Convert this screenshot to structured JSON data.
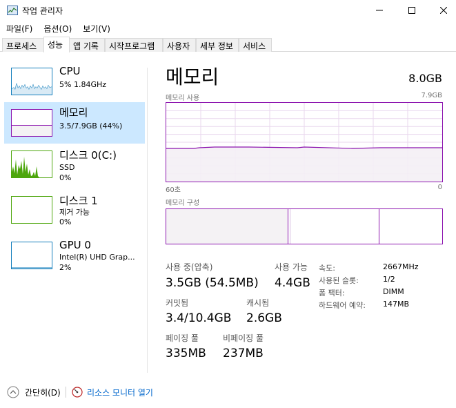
{
  "window": {
    "title": "작업 관리자"
  },
  "menu": [
    "파일(F)",
    "옵션(O)",
    "보기(V)"
  ],
  "tabs": [
    "프로세스",
    "성능",
    "앱 기록",
    "시작프로그램",
    "사용자",
    "세부 정보",
    "서비스"
  ],
  "active_tab": "성능",
  "sidebar": {
    "items": [
      {
        "title": "CPU",
        "line1": "5%  1.84GHz",
        "line2": "",
        "color": "#117dbb"
      },
      {
        "title": "메모리",
        "line1": "3.5/7.9GB (44%)",
        "line2": "",
        "color": "#8b12ae"
      },
      {
        "title": "디스크 0(C:)",
        "line1": "SSD",
        "line2": "0%",
        "color": "#4da60c"
      },
      {
        "title": "디스크 1",
        "line1": "제거 가능",
        "line2": "0%",
        "color": "#4da60c"
      },
      {
        "title": "GPU 0",
        "line1": "Intel(R) UHD Grap...",
        "line2": "2%",
        "color": "#117dbb"
      }
    ]
  },
  "main": {
    "title": "메모리",
    "capacity": "8.0GB",
    "usage_graph": {
      "label": "메모리 사용",
      "max": "7.9GB",
      "time_left": "60초",
      "time_right": "0"
    },
    "composition_label": "메모리 구성",
    "stats": {
      "in_use_label": "사용 중(압축)",
      "in_use_value": "3.5GB (54.5MB)",
      "available_label": "사용 가능",
      "available_value": "4.4GB",
      "committed_label": "커밋됨",
      "committed_value": "3.4/10.4GB",
      "cached_label": "캐시됨",
      "cached_value": "2.6GB",
      "paged_label": "페이징 풀",
      "paged_value": "335MB",
      "nonpaged_label": "비페이징 풀",
      "nonpaged_value": "237MB"
    },
    "details": [
      {
        "label": "속도:",
        "value": "2667MHz"
      },
      {
        "label": "사용된 슬롯:",
        "value": "1/2"
      },
      {
        "label": "폼 팩터:",
        "value": "DIMM"
      },
      {
        "label": "하드웨어 예약:",
        "value": "147MB"
      }
    ]
  },
  "footer": {
    "simple_label": "간단히(D)",
    "resource_monitor_label": "리소스 모니터 열기"
  }
}
